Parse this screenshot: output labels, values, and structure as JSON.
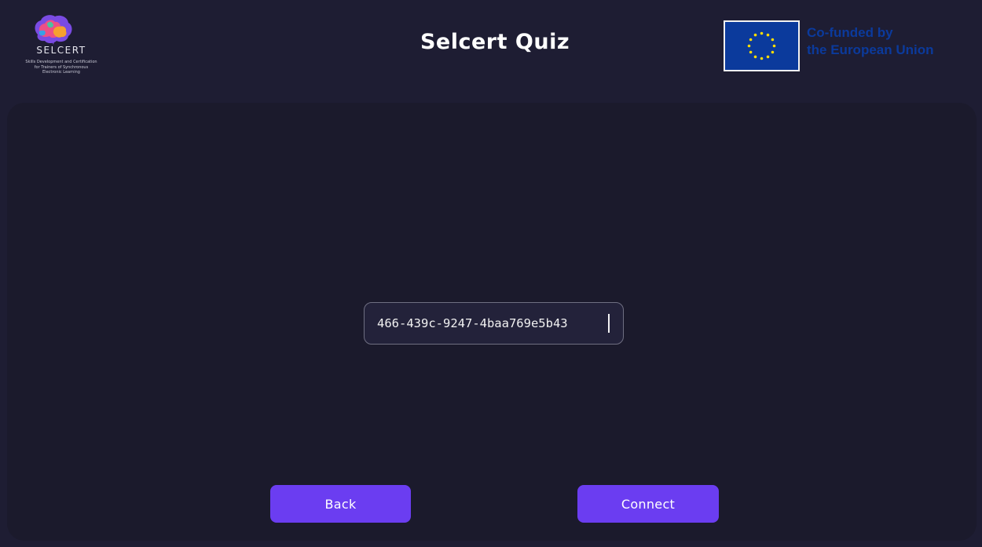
{
  "header": {
    "logo": {
      "wordmark": "SELCERT",
      "tagline": "Skills Development and Certification\nfor Trainers of Synchronous\nElectronic Learning"
    },
    "title": "Selcert Quiz",
    "funding": {
      "line1": "Co-funded by",
      "line2": "the European Union"
    }
  },
  "main": {
    "code_input": {
      "value": "466-439c-9247-4baa769e5b43"
    },
    "back_label": "Back",
    "connect_label": "Connect"
  },
  "colors": {
    "background": "#1e1d33",
    "panel": "#1b1a2c",
    "accent": "#6b3df1",
    "eu_blue": "#0b3a9c",
    "eu_star": "#ffdd00"
  }
}
